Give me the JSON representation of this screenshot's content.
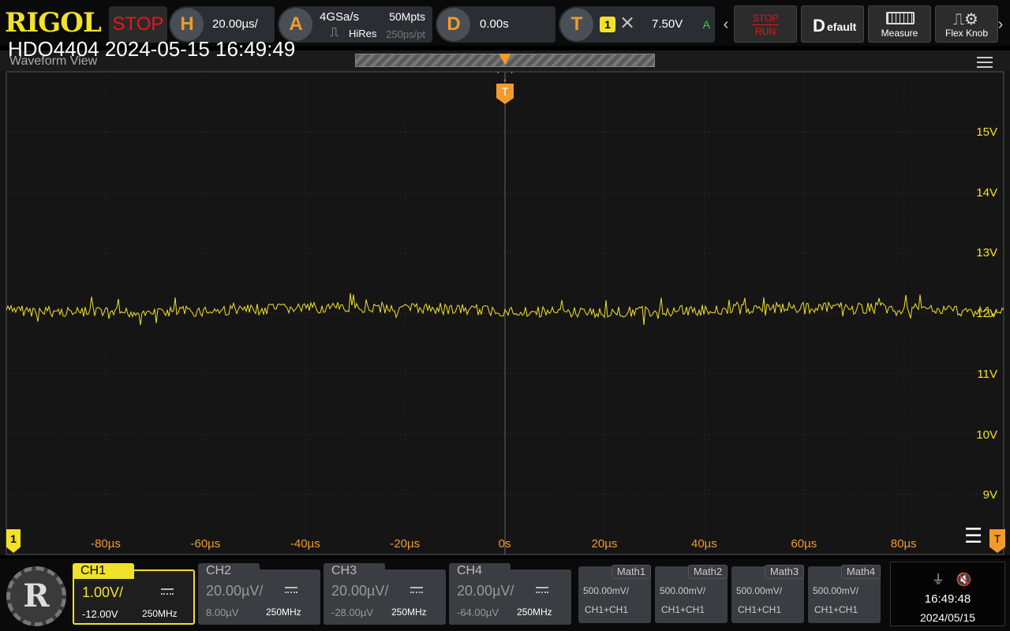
{
  "header": {
    "brand": "RIGOL",
    "run_state": "STOP",
    "horizontal": {
      "icon": "H",
      "timebase": "20.00µs/"
    },
    "acquire": {
      "icon": "A",
      "sample_rate": "4GSa/s",
      "memory_depth": "50Mpts",
      "mode": "HiRes",
      "resolution": "250ps/pt"
    },
    "delay": {
      "icon": "D",
      "value": "0.00s"
    },
    "trigger": {
      "icon": "T",
      "source": "1",
      "level": "7.50V",
      "mode": "A"
    },
    "buttons": {
      "stop_run_top": "STOP",
      "stop_run_bottom": "RUN",
      "default_big": "D",
      "default_rest": "efault",
      "measure": "Measure",
      "flex_knob": "Flex Knob"
    }
  },
  "overlay": {
    "title": "HDO4404 2024-05-15 16:49:49",
    "view_label": "Waveform View"
  },
  "grid": {
    "voltage_labels": [
      "15V",
      "14V",
      "13V",
      "12V",
      "11V",
      "10V",
      "9V"
    ],
    "time_labels": [
      "-80µs",
      "-60µs",
      "-40µs",
      "-20µs",
      "0s",
      "20µs",
      "40µs",
      "60µs",
      "80µs"
    ],
    "trigger_marker": "T",
    "ch1_marker": "1",
    "trigger_level_marker": "T"
  },
  "waveform": {
    "color": "#f2e12b",
    "mean_v": 12.0
  },
  "channels": [
    {
      "name": "CH1",
      "scale": "1.00V/",
      "offset": "-12.00V",
      "bandwidth": "250MHz",
      "active": true
    },
    {
      "name": "CH2",
      "scale": "20.00µV/",
      "offset": "8.00µV",
      "bandwidth": "250MHz",
      "active": false
    },
    {
      "name": "CH3",
      "scale": "20.00µV/",
      "offset": "-28.00µV",
      "bandwidth": "250MHz",
      "active": false
    },
    {
      "name": "CH4",
      "scale": "20.00µV/",
      "offset": "-64.00µV",
      "bandwidth": "250MHz",
      "active": false
    }
  ],
  "math": [
    {
      "name": "Math1",
      "scale": "500.00mV/",
      "expr": "CH1+CH1"
    },
    {
      "name": "Math2",
      "scale": "500.00mV/",
      "expr": "CH1+CH1"
    },
    {
      "name": "Math3",
      "scale": "500.00mV/",
      "expr": "CH1+CH1"
    },
    {
      "name": "Math4",
      "scale": "500.00mV/",
      "expr": "CH1+CH1"
    }
  ],
  "status": {
    "time": "16:49:48",
    "date": "2024/05/15",
    "usb_icon": "usb-icon",
    "mute_icon": "speaker-mute-icon"
  },
  "colors": {
    "ch1": "#f2e12b",
    "trigger": "#f29a2e",
    "stop": "#e8161a"
  }
}
